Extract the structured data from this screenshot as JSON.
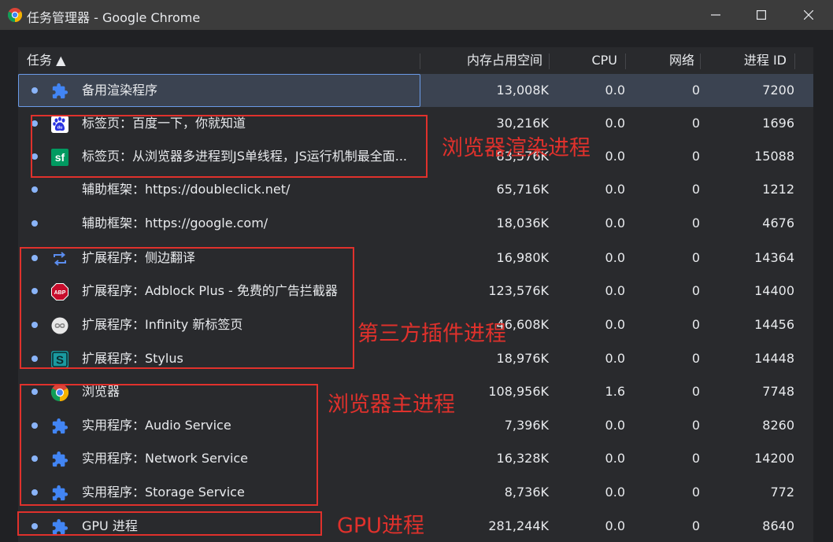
{
  "window": {
    "title": "任务管理器 - Google Chrome"
  },
  "columns": {
    "task": "任务 ▲",
    "memory": "内存占用空间",
    "cpu": "CPU",
    "network": "网络",
    "pid": "进程 ID"
  },
  "rows": [
    {
      "name": "备用渲染程序",
      "memory": "13,008K",
      "cpu": "0.0",
      "network": "0",
      "pid": "7200",
      "icon": "puzzle-icon"
    },
    {
      "name": "标签页：百度一下，你就知道",
      "memory": "30,216K",
      "cpu": "0.0",
      "network": "0",
      "pid": "1696",
      "icon": "baidu-icon"
    },
    {
      "name": "标签页：从浏览器多进程到JS单线程，JS运行机制最全面...",
      "memory": "83,576K",
      "cpu": "0.0",
      "network": "0",
      "pid": "15088",
      "icon": "segmentfault-icon",
      "icon_text": "sf"
    },
    {
      "name": "辅助框架：https://doubleclick.net/",
      "memory": "65,716K",
      "cpu": "0.0",
      "network": "0",
      "pid": "1212",
      "icon": "none"
    },
    {
      "name": "辅助框架：https://google.com/",
      "memory": "18,036K",
      "cpu": "0.0",
      "network": "0",
      "pid": "4676",
      "icon": "none"
    },
    {
      "name": "扩展程序：侧边翻译",
      "memory": "16,980K",
      "cpu": "0.0",
      "network": "0",
      "pid": "14364",
      "icon": "translate-icon"
    },
    {
      "name": "扩展程序：Adblock Plus - 免费的广告拦截器",
      "memory": "123,576K",
      "cpu": "0.0",
      "network": "0",
      "pid": "14400",
      "icon": "adblock-icon",
      "icon_text": "ABP"
    },
    {
      "name": "扩展程序：Infinity 新标签页",
      "memory": "46,608K",
      "cpu": "0.0",
      "network": "0",
      "pid": "14456",
      "icon": "infinity-icon"
    },
    {
      "name": "扩展程序：Stylus",
      "memory": "18,976K",
      "cpu": "0.0",
      "network": "0",
      "pid": "14448",
      "icon": "stylus-icon",
      "icon_text": "S"
    },
    {
      "name": "浏览器",
      "memory": "108,956K",
      "cpu": "1.6",
      "network": "0",
      "pid": "7748",
      "icon": "chrome-icon"
    },
    {
      "name": "实用程序：Audio Service",
      "memory": "7,396K",
      "cpu": "0.0",
      "network": "0",
      "pid": "8260",
      "icon": "puzzle-icon"
    },
    {
      "name": "实用程序：Network Service",
      "memory": "16,328K",
      "cpu": "0.0",
      "network": "0",
      "pid": "14200",
      "icon": "puzzle-icon"
    },
    {
      "name": "实用程序：Storage Service",
      "memory": "8,736K",
      "cpu": "0.0",
      "network": "0",
      "pid": "772",
      "icon": "puzzle-icon"
    },
    {
      "name": "GPU 进程",
      "memory": "281,244K",
      "cpu": "0.0",
      "network": "0",
      "pid": "8640",
      "icon": "puzzle-icon"
    }
  ],
  "annotations": [
    {
      "label": "浏览器渲染进程"
    },
    {
      "label": "第三方插件进程"
    },
    {
      "label": "浏览器主进程"
    },
    {
      "label": "GPU进程"
    }
  ],
  "colors": {
    "annotation": "#e0312c",
    "accent": "#8ab4f8",
    "selected": "#3b4351"
  }
}
